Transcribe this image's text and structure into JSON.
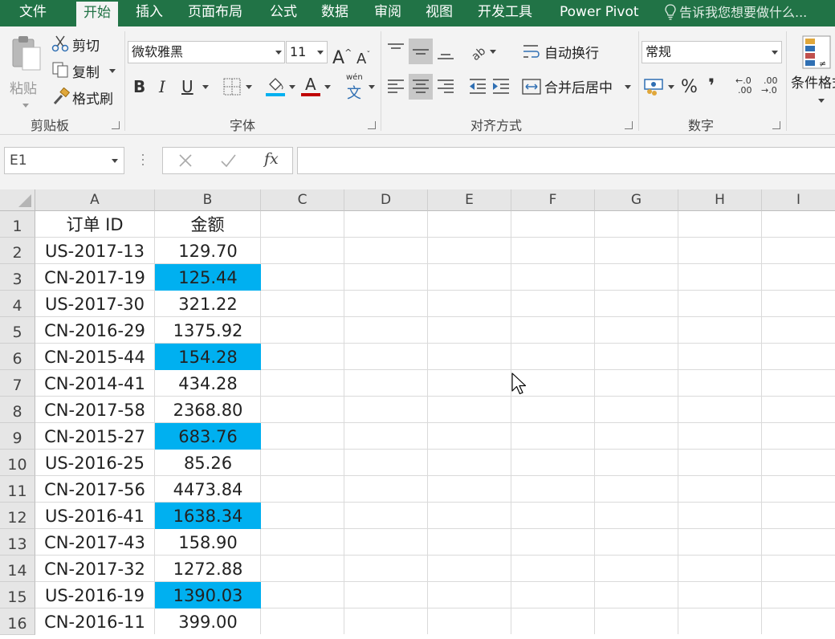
{
  "menu": {
    "tabs": [
      {
        "label": "文件",
        "active": false
      },
      {
        "label": "开始",
        "active": true
      },
      {
        "label": "插入",
        "active": false
      },
      {
        "label": "页面布局",
        "active": false
      },
      {
        "label": "公式",
        "active": false
      },
      {
        "label": "数据",
        "active": false
      },
      {
        "label": "审阅",
        "active": false
      },
      {
        "label": "视图",
        "active": false
      },
      {
        "label": "开发工具",
        "active": false
      },
      {
        "label": "Power Pivot",
        "active": false
      }
    ],
    "tell_me": "告诉我您想要做什么..."
  },
  "ribbon": {
    "clipboard": {
      "group_label": "剪贴板",
      "paste": "粘贴",
      "cut": "剪切",
      "copy": "复制",
      "format_painter": "格式刷"
    },
    "font": {
      "group_label": "字体",
      "font_name": "微软雅黑",
      "font_size": "11",
      "bold": "B",
      "italic": "I",
      "underline": "U",
      "phonetic_top": "wén",
      "phonetic_bottom": "文"
    },
    "alignment": {
      "group_label": "对齐方式",
      "wrap_text": "自动换行",
      "merge_center": "合并后居中"
    },
    "number": {
      "group_label": "数字",
      "format": "常规",
      "percent": "%",
      "comma": "❜",
      "inc_decimal_top": "←.0",
      "inc_decimal_bottom": ".00",
      "dec_decimal_top": ".00",
      "dec_decimal_bottom": "→.0"
    },
    "styles": {
      "conditional_format": "条件格式"
    }
  },
  "formula_bar": {
    "name_box": "E1",
    "fx": "fx",
    "formula": ""
  },
  "sheet": {
    "columns": [
      "A",
      "B",
      "C",
      "D",
      "E",
      "F",
      "G",
      "H",
      "I"
    ],
    "highlight_color": "#00b0f0",
    "header_row": {
      "num": "1",
      "a": "订单 ID",
      "b": "金额"
    },
    "rows": [
      {
        "num": "2",
        "a": "US-2017-13",
        "b": "129.70",
        "highlight": false
      },
      {
        "num": "3",
        "a": "CN-2017-19",
        "b": "125.44",
        "highlight": true
      },
      {
        "num": "4",
        "a": "US-2017-30",
        "b": "321.22",
        "highlight": false
      },
      {
        "num": "5",
        "a": "CN-2016-29",
        "b": "1375.92",
        "highlight": false
      },
      {
        "num": "6",
        "a": "CN-2015-44",
        "b": "154.28",
        "highlight": true
      },
      {
        "num": "7",
        "a": "CN-2014-41",
        "b": "434.28",
        "highlight": false
      },
      {
        "num": "8",
        "a": "CN-2017-58",
        "b": "2368.80",
        "highlight": false
      },
      {
        "num": "9",
        "a": "CN-2015-27",
        "b": "683.76",
        "highlight": true
      },
      {
        "num": "10",
        "a": "US-2016-25",
        "b": "85.26",
        "highlight": false
      },
      {
        "num": "11",
        "a": "CN-2017-56",
        "b": "4473.84",
        "highlight": false
      },
      {
        "num": "12",
        "a": "US-2016-41",
        "b": "1638.34",
        "highlight": true
      },
      {
        "num": "13",
        "a": "CN-2017-43",
        "b": "158.90",
        "highlight": false
      },
      {
        "num": "14",
        "a": "CN-2017-32",
        "b": "1272.88",
        "highlight": false
      },
      {
        "num": "15",
        "a": "US-2016-19",
        "b": "1390.03",
        "highlight": true
      },
      {
        "num": "16",
        "a": "CN-2016-11",
        "b": "399.00",
        "highlight": false
      }
    ]
  }
}
